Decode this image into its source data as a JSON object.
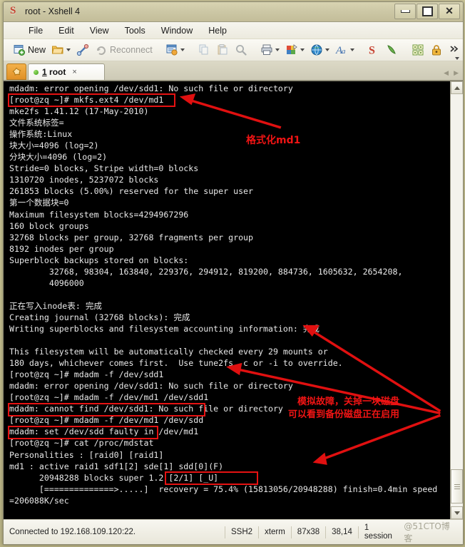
{
  "window": {
    "title": "root - Xshell 4",
    "app_icon": "xshell-icon",
    "buttons": {
      "minimize": "minimize",
      "maximize": "maximize",
      "close": "close"
    }
  },
  "menubar": {
    "items": [
      "File",
      "Edit",
      "View",
      "Tools",
      "Window",
      "Help"
    ]
  },
  "toolbar": {
    "new_label": "New",
    "reconnect_label": "Reconnect",
    "icons": [
      "new-session-icon",
      "open-folder-icon",
      "connect-link-icon",
      "reconnect-icon",
      "session-manager-icon",
      "copy-icon",
      "paste-icon",
      "find-icon",
      "print-icon",
      "transfer-icon",
      "web-icon",
      "font-icon",
      "xshell-icon",
      "xftp-icon",
      "layout-icon",
      "lock-icon",
      "overflow-icon"
    ]
  },
  "tabbar": {
    "add_tab_icon": "new-tab-icon",
    "tabs": [
      {
        "index": "1",
        "label": "root",
        "status": "connected",
        "close": "×"
      }
    ]
  },
  "terminal": {
    "lines": [
      "mdadm: error opening /dev/sdd1: No such file or directory",
      "[root@zq ~]# mkfs.ext4 /dev/md1",
      "mke2fs 1.41.12 (17-May-2010)",
      "文件系统标签=",
      "操作系统:Linux",
      "块大小=4096 (log=2)",
      "分块大小=4096 (log=2)",
      "Stride=0 blocks, Stripe width=0 blocks",
      "1310720 inodes, 5237072 blocks",
      "261853 blocks (5.00%) reserved for the super user",
      "第一个数据块=0",
      "Maximum filesystem blocks=4294967296",
      "160 block groups",
      "32768 blocks per group, 32768 fragments per group",
      "8192 inodes per group",
      "Superblock backups stored on blocks:",
      "        32768, 98304, 163840, 229376, 294912, 819200, 884736, 1605632, 2654208,",
      "        4096000",
      "",
      "正在写入inode表: 完成",
      "Creating journal (32768 blocks): 完成",
      "Writing superblocks and filesystem accounting information: 完成",
      "",
      "This filesystem will be automatically checked every 29 mounts or",
      "180 days, whichever comes first.  Use tune2fs -c or -i to override.",
      "[root@zq ~]# mdadm -f /dev/sdd1",
      "mdadm: error opening /dev/sdd1: No such file or directory",
      "[root@zq ~]# mdadm -f /dev/md1 /dev/sdd1",
      "mdadm: cannot find /dev/sdd1: No such file or directory",
      "[root@zq ~]# mdadm -f /dev/md1 /dev/sdd",
      "mdadm: set /dev/sdd faulty in /dev/md1",
      "[root@zq ~]# cat /proc/mdstat",
      "Personalities : [raid0] [raid1]",
      "md1 : active raid1 sdf1[2] sde[1] sdd[0](F)",
      "      20948288 blocks super 1.2 [2/1] [_U]",
      "      [==============>.....]  recovery = 75.4% (15813056/20948288) finish=0.4min speed",
      "=206088K/sec",
      ""
    ]
  },
  "annotations": {
    "color": "#e61212",
    "notes": [
      {
        "text": "格式化md1",
        "target": "mkfs-command"
      },
      {
        "text": "模拟故障，关掉一块磁盘",
        "target": "fail-disk-command"
      },
      {
        "text": "可以看到备份磁盘正在启用",
        "target": "recovery-progress"
      }
    ],
    "highlight_boxes": [
      "mkfs-ext4-md1-command",
      "mdadm-fail-sdd-command",
      "cat-proc-mdstat-command",
      "recovery-percent"
    ]
  },
  "scrollbar": {
    "up": "scroll-up",
    "down": "scroll-down"
  },
  "statusbar": {
    "connection": "Connected to 192.168.109.120:22.",
    "protocol": "SSH2",
    "terminal_type": "xterm",
    "size": "87x38",
    "cursor": "38,14",
    "sessions": "1 session",
    "watermark": "@51CTO博客"
  }
}
